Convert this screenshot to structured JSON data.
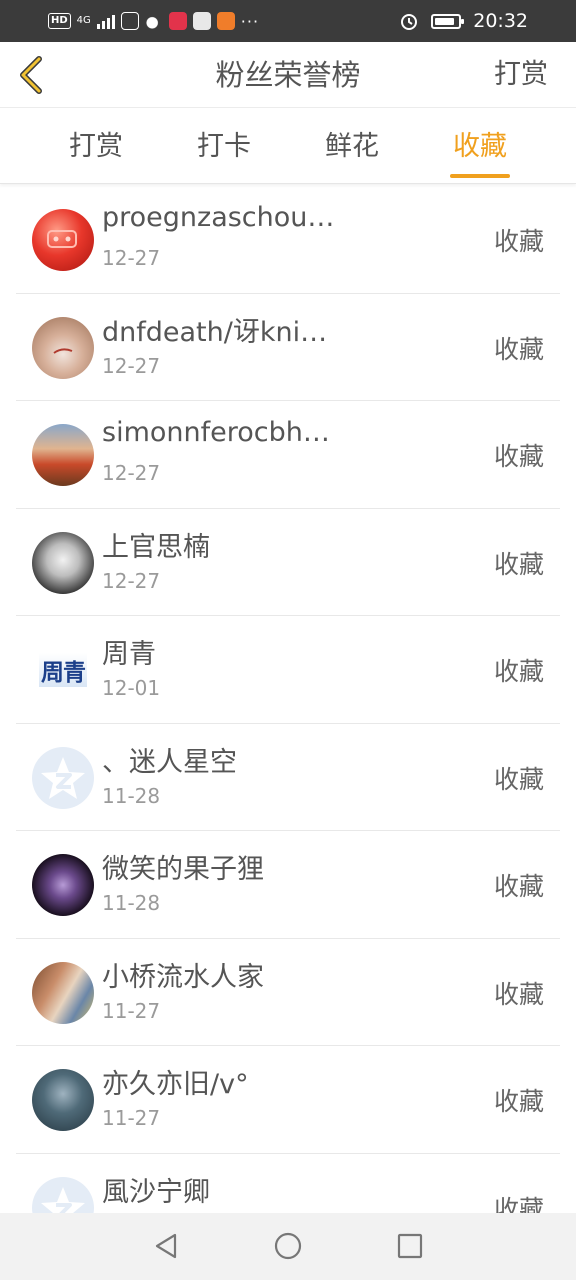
{
  "status_bar": {
    "hd_badge": "HD",
    "network": "4G",
    "time": "20:32",
    "battery_level": 0.85
  },
  "nav": {
    "title": "粉丝荣誉榜",
    "action": "打赏"
  },
  "tabs": [
    {
      "label": "打赏",
      "active": false
    },
    {
      "label": "打卡",
      "active": false
    },
    {
      "label": "鲜花",
      "active": false
    },
    {
      "label": "收藏",
      "active": true
    }
  ],
  "accent_color": "#f0a01e",
  "items": [
    {
      "name": "proegnzaschou…",
      "date": "12-27",
      "action": "收藏",
      "avatar_icon": "red-ball-avatar"
    },
    {
      "name": "dnfdeath/讶kni…",
      "date": "12-27",
      "action": "收藏",
      "avatar_icon": "photo-avatar"
    },
    {
      "name": "simonnferocbh…",
      "date": "12-27",
      "action": "收藏",
      "avatar_icon": "sunset-avatar"
    },
    {
      "name": "上官思楠",
      "date": "12-27",
      "action": "收藏",
      "avatar_icon": "angel-avatar"
    },
    {
      "name": "周青",
      "date": "12-01",
      "action": "收藏",
      "avatar_icon": "text-avatar",
      "avatar_text": "周青"
    },
    {
      "name": "、迷人星空",
      "date": "11-28",
      "action": "收藏",
      "avatar_icon": "qzone-default-avatar"
    },
    {
      "name": "微笑的果子狸",
      "date": "11-28",
      "action": "收藏",
      "avatar_icon": "purple-avatar"
    },
    {
      "name": "小桥流水人家",
      "date": "11-27",
      "action": "收藏",
      "avatar_icon": "couple-avatar"
    },
    {
      "name": "亦久亦旧/v°",
      "date": "11-27",
      "action": "收藏",
      "avatar_icon": "dark-photo-avatar"
    },
    {
      "name": "風沙宁卿",
      "date": "",
      "action": "收藏",
      "avatar_icon": "qzone-default-avatar"
    }
  ]
}
